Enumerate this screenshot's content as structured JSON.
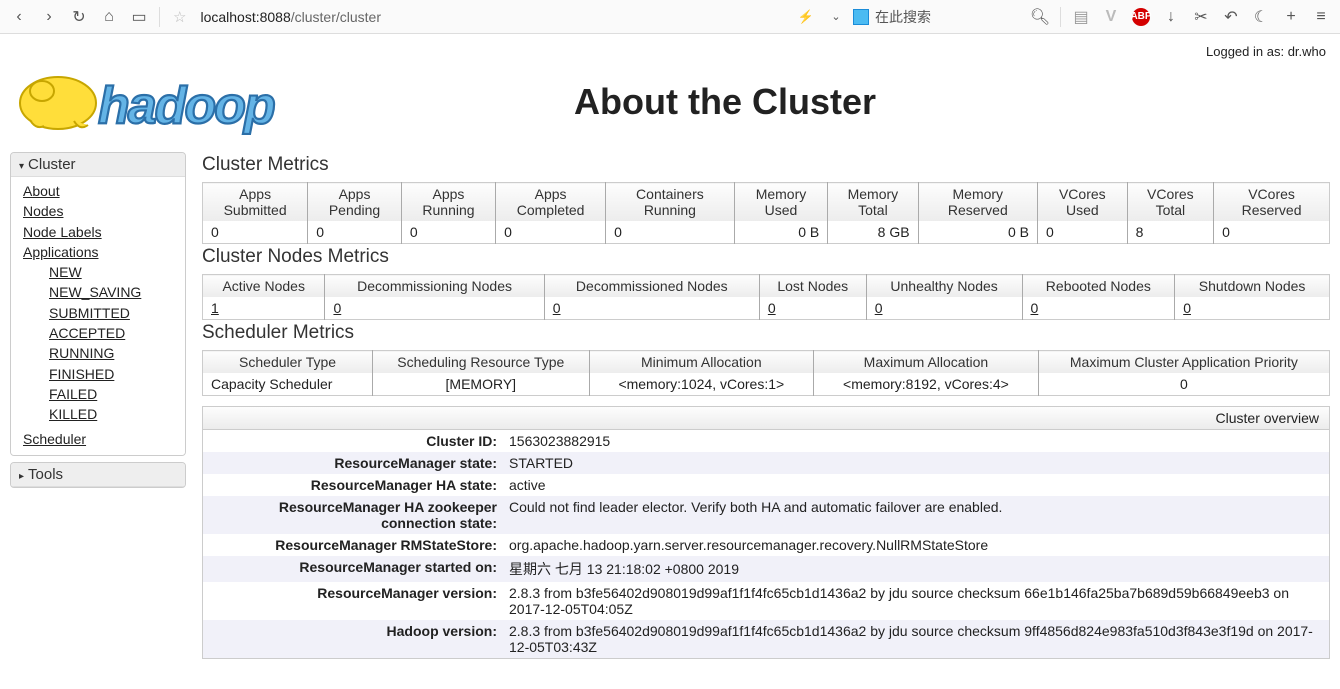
{
  "browser": {
    "url_host": "localhost:8088",
    "url_path": "/cluster/cluster",
    "search_placeholder": "在此搜索"
  },
  "login": {
    "prefix": "Logged in as: ",
    "user": "dr.who"
  },
  "page_title": "About the Cluster",
  "sidebar": {
    "cluster_label": "Cluster",
    "items": [
      "About",
      "Nodes",
      "Node Labels",
      "Applications"
    ],
    "app_states": [
      "NEW",
      "NEW_SAVING",
      "SUBMITTED",
      "ACCEPTED",
      "RUNNING",
      "FINISHED",
      "FAILED",
      "KILLED"
    ],
    "scheduler_label": "Scheduler",
    "tools_label": "Tools"
  },
  "cluster_metrics": {
    "heading": "Cluster Metrics",
    "headers": [
      "Apps Submitted",
      "Apps Pending",
      "Apps Running",
      "Apps Completed",
      "Containers Running",
      "Memory Used",
      "Memory Total",
      "Memory Reserved",
      "VCores Used",
      "VCores Total",
      "VCores Reserved"
    ],
    "values": [
      "0",
      "0",
      "0",
      "0",
      "0",
      "0 B",
      "8 GB",
      "0 B",
      "0",
      "8",
      "0"
    ]
  },
  "nodes_metrics": {
    "heading": "Cluster Nodes Metrics",
    "headers": [
      "Active Nodes",
      "Decommissioning Nodes",
      "Decommissioned Nodes",
      "Lost Nodes",
      "Unhealthy Nodes",
      "Rebooted Nodes",
      "Shutdown Nodes"
    ],
    "values": [
      "1",
      "0",
      "0",
      "0",
      "0",
      "0",
      "0"
    ]
  },
  "scheduler_metrics": {
    "heading": "Scheduler Metrics",
    "headers": [
      "Scheduler Type",
      "Scheduling Resource Type",
      "Minimum Allocation",
      "Maximum Allocation",
      "Maximum Cluster Application Priority"
    ],
    "values": [
      "Capacity Scheduler",
      "[MEMORY]",
      "<memory:1024, vCores:1>",
      "<memory:8192, vCores:4>",
      "0"
    ]
  },
  "overview": {
    "title": "Cluster overview",
    "rows": [
      {
        "k": "Cluster ID:",
        "v": "1563023882915"
      },
      {
        "k": "ResourceManager state:",
        "v": "STARTED"
      },
      {
        "k": "ResourceManager HA state:",
        "v": "active"
      },
      {
        "k": "ResourceManager HA zookeeper connection state:",
        "v": "Could not find leader elector. Verify both HA and automatic failover are enabled."
      },
      {
        "k": "ResourceManager RMStateStore:",
        "v": "org.apache.hadoop.yarn.server.resourcemanager.recovery.NullRMStateStore"
      },
      {
        "k": "ResourceManager started on:",
        "v": "星期六 七月 13 21:18:02 +0800 2019"
      },
      {
        "k": "ResourceManager version:",
        "v": "2.8.3 from b3fe56402d908019d99af1f1f4fc65cb1d1436a2 by jdu source checksum 66e1b146fa25ba7b689d59b66849eeb3 on 2017-12-05T04:05Z"
      },
      {
        "k": "Hadoop version:",
        "v": "2.8.3 from b3fe56402d908019d99af1f1f4fc65cb1d1436a2 by jdu source checksum 9ff4856d824e983fa510d3f843e3f19d on 2017-12-05T03:43Z"
      }
    ]
  }
}
